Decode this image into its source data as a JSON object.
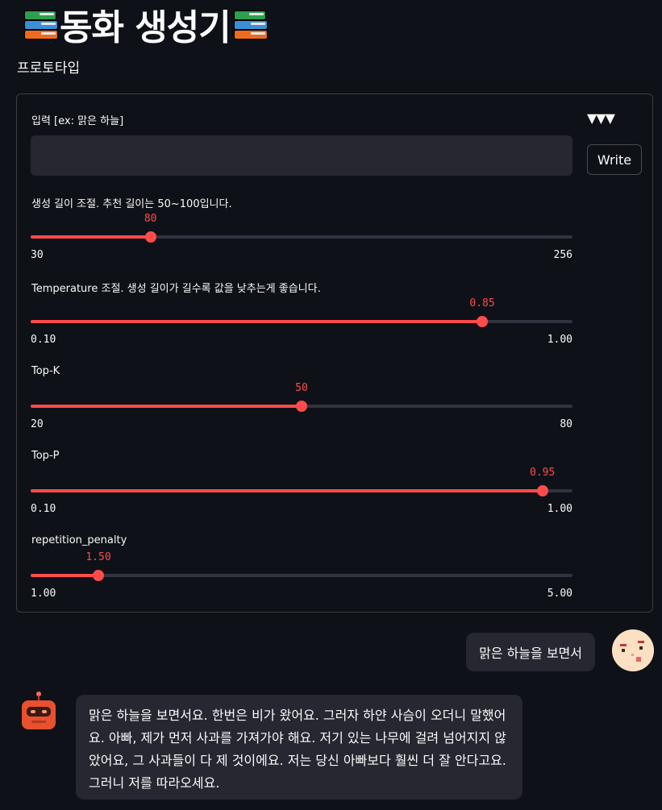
{
  "header": {
    "title": "동화 생성기",
    "left_icon": "books-icon",
    "right_icon": "books-icon",
    "subtitle": "프로토타입"
  },
  "form": {
    "input_label": "입력 [ex: 맑은 하늘]",
    "input_value": "",
    "arrows": "▼▼▼",
    "write_label": "Write",
    "sliders": [
      {
        "label": "생성 길이 조절. 추천 길이는 50~100입니다.",
        "value": 80,
        "value_text": "80",
        "min": 30,
        "max": 256,
        "min_text": "30",
        "max_text": "256"
      },
      {
        "label": "Temperature 조절. 생성 길이가 길수록 값을 낮추는게 좋습니다.",
        "value": 0.85,
        "value_text": "0.85",
        "min": 0.1,
        "max": 1.0,
        "min_text": "0.10",
        "max_text": "1.00"
      },
      {
        "label": "Top-K",
        "value": 50,
        "value_text": "50",
        "min": 20,
        "max": 80,
        "min_text": "20",
        "max_text": "80"
      },
      {
        "label": "Top-P",
        "value": 0.95,
        "value_text": "0.95",
        "min": 0.1,
        "max": 1.0,
        "min_text": "0.10",
        "max_text": "1.00"
      },
      {
        "label": "repetition_penalty",
        "value": 1.5,
        "value_text": "1.50",
        "min": 1.0,
        "max": 5.0,
        "min_text": "1.00",
        "max_text": "5.00"
      }
    ]
  },
  "chat": {
    "user_message": "맑은 하늘을 보면서",
    "user_avatar": "user-avatar-icon",
    "bot_avatar": "robot-avatar-icon",
    "bot_message": "맑은 하늘을 보면서요. 한번은 비가 왔어요. 그러자 하얀 사슴이 오더니 말했어요. 아빠, 제가 먼저 사과를 가져가야 해요. 저기 있는 나무에 걸려 넘어지지 않았어요, 그 사과들이 다 제 것이에요. 저는 당신 아빠보다 훨씬 더 잘 안다고요. 그러니 저를 따라오세요."
  },
  "colors": {
    "background": "#0e1117",
    "accent": "#ff4b4b",
    "panel": "#262730",
    "track": "#31333f"
  }
}
